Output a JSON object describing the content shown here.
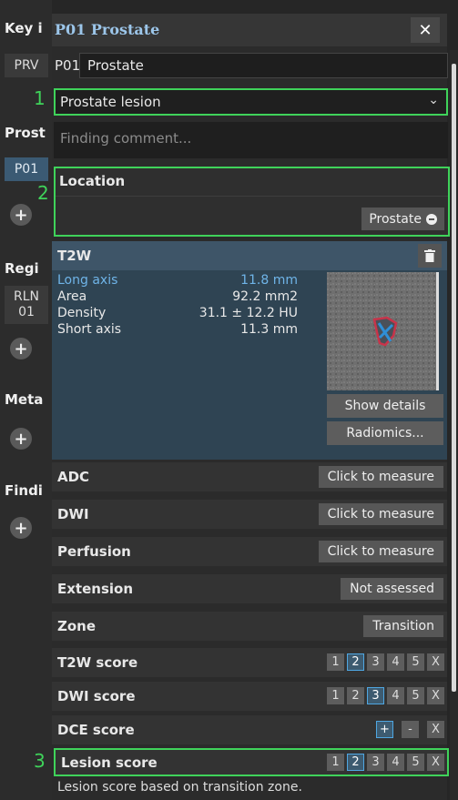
{
  "sidebar": {
    "key_heading": "Key i",
    "prv_tag": "PRV",
    "prostate_heading": "Prost",
    "p01_tag": "P01",
    "region_heading": "Regi",
    "rln_tag_line1": "RLN",
    "rln_tag_line2": "01",
    "meta_heading": "Meta",
    "findings_heading": "Findi"
  },
  "panel": {
    "title": "P01 Prostate",
    "close_icon": "close-icon",
    "finding_id": "P01",
    "finding_name": "Prostate",
    "finding_type": "Prostate lesion",
    "comment_placeholder": "Finding comment...",
    "location_label": "Location",
    "location_value": "Prostate",
    "markers": [
      "1",
      "2",
      "3"
    ]
  },
  "t2w": {
    "label": "T2W",
    "measurements": [
      {
        "key": "Long axis",
        "value": "11.8 mm"
      },
      {
        "key": "Area",
        "value": "92.2 mm2"
      },
      {
        "key": "Density",
        "value": "31.1 ± 12.2 HU"
      },
      {
        "key": "Short axis",
        "value": "11.3 mm"
      }
    ],
    "show_details": "Show details",
    "radiomics": "Radiomics..."
  },
  "rows": [
    {
      "label": "ADC",
      "action": "Click to measure"
    },
    {
      "label": "DWI",
      "action": "Click to measure"
    },
    {
      "label": "Perfusion",
      "action": "Click to measure"
    },
    {
      "label": "Extension",
      "action": "Not assessed"
    },
    {
      "label": "Zone",
      "action": "Transition"
    }
  ],
  "scores": {
    "options": [
      "1",
      "2",
      "3",
      "4",
      "5",
      "X"
    ],
    "t2w_label": "T2W score",
    "t2w_selected": "2",
    "dwi_label": "DWI score",
    "dwi_selected": "3",
    "dce_label": "DCE score",
    "dce_plus": "+",
    "dce_minus": "-",
    "dce_x": "X",
    "lesion_label": "Lesion score",
    "lesion_selected": "2",
    "lesion_note": "Lesion score based on transition zone."
  },
  "colors": {
    "highlight_box": "#3fd35a",
    "accent_blue": "#6fb4e8",
    "title_blue": "#9cc6ea"
  }
}
